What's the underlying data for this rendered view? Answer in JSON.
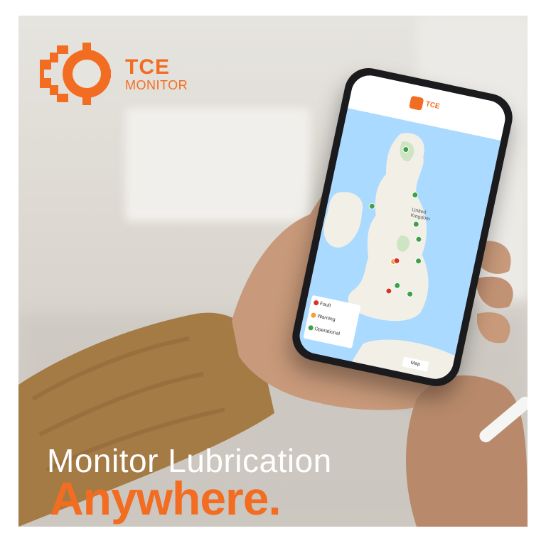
{
  "brand": {
    "logo_icon": "gear-logo-icon",
    "name_line1": "TCE",
    "name_line2": "MONITOR",
    "accent_color": "#f26d21"
  },
  "headline": {
    "line1": "Monitor Lubrication",
    "line2": "Anywhere."
  },
  "phone_screen": {
    "app_logo_text": "TCE",
    "map_labels": {
      "country": "United Kingdom"
    },
    "legend": [
      {
        "label": "Fault",
        "color": "#d9322b"
      },
      {
        "label": "Warning",
        "color": "#f0a13a"
      },
      {
        "label": "Operational",
        "color": "#3ea04a"
      }
    ],
    "map_toggle_label": "Map"
  }
}
